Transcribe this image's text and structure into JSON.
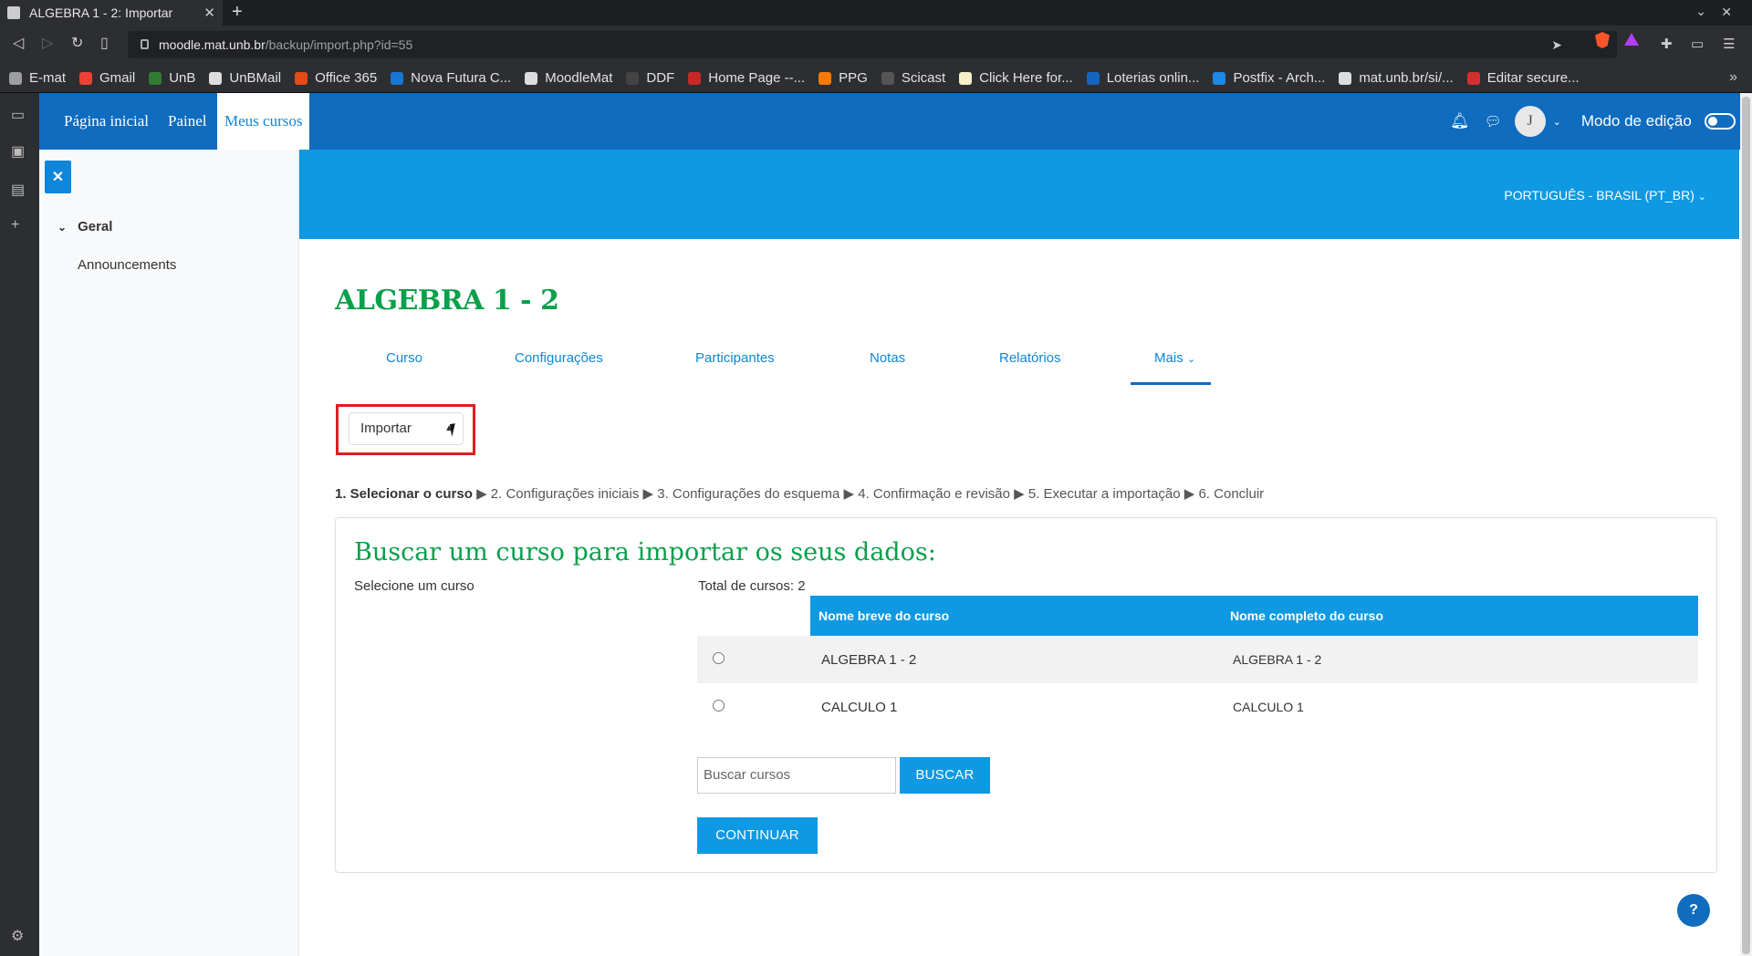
{
  "browser": {
    "tab_title": "ALGEBRA 1 - 2: Importar",
    "url_host": "moodle.mat.unb.br",
    "url_path": "/backup/import.php?id=55",
    "bookmarks": [
      {
        "label": "E-mat",
        "color": "#9e9e9e"
      },
      {
        "label": "Gmail",
        "color": "#ea4335"
      },
      {
        "label": "UnB",
        "color": "#2e7d32"
      },
      {
        "label": "UnBMail",
        "color": "#dddddd"
      },
      {
        "label": "Office 365",
        "color": "#e64a19"
      },
      {
        "label": "Nova Futura C...",
        "color": "#1976d2"
      },
      {
        "label": "MoodleMat",
        "color": "#dddddd"
      },
      {
        "label": "DDF",
        "color": "#444444"
      },
      {
        "label": "Home Page --...",
        "color": "#c62828"
      },
      {
        "label": "PPG",
        "color": "#f57c00"
      },
      {
        "label": "Scicast",
        "color": "#555555"
      },
      {
        "label": "Click Here for...",
        "color": "#f5f0c8"
      },
      {
        "label": "Loterias onlin...",
        "color": "#1565c0"
      },
      {
        "label": "Postfix - Arch...",
        "color": "#1e88e5"
      },
      {
        "label": "mat.unb.br/si/...",
        "color": "#dddddd"
      },
      {
        "label": "Editar secure...",
        "color": "#d32f2f"
      }
    ]
  },
  "navbar": {
    "links": [
      "Página inicial",
      "Painel",
      "Meus cursos"
    ],
    "edit_mode_label": "Modo de edição",
    "avatar_initial": "J",
    "language": "PORTUGUÊS - BRASIL (PT_BR)"
  },
  "drawer": {
    "section": "Geral",
    "items": [
      "Announcements"
    ]
  },
  "course": {
    "title": "ALGEBRA 1 - 2",
    "tabs": [
      "Curso",
      "Configurações",
      "Participantes",
      "Notas",
      "Relatórios",
      "Mais"
    ],
    "action_select_value": "Importar"
  },
  "steps": {
    "current": "1. Selecionar o curso",
    "rest": " ▶ 2. Configurações iniciais ▶ 3. Configurações do esquema ▶ 4. Confirmação e revisão ▶ 5. Executar a importação ▶ 6. Concluir"
  },
  "import": {
    "heading": "Buscar um curso para importar os seus dados:",
    "select_label": "Selecione um curso",
    "total_label": "Total de cursos: 2",
    "columns": [
      "Nome breve do curso",
      "Nome completo do curso"
    ],
    "rows": [
      {
        "short": "ALGEBRA 1 - 2",
        "full": "ALGEBRA 1 - 2"
      },
      {
        "short": "CALCULO 1",
        "full": "CALCULO 1"
      }
    ],
    "search_placeholder": "Buscar cursos",
    "search_button": "BUSCAR",
    "continue_button": "CONTINUAR"
  },
  "help": "?",
  "colors": {
    "navbar": "#0f6cbf",
    "banner": "#0f99e3",
    "title_green": "#08a04b",
    "highlight_red": "#e31b23"
  }
}
